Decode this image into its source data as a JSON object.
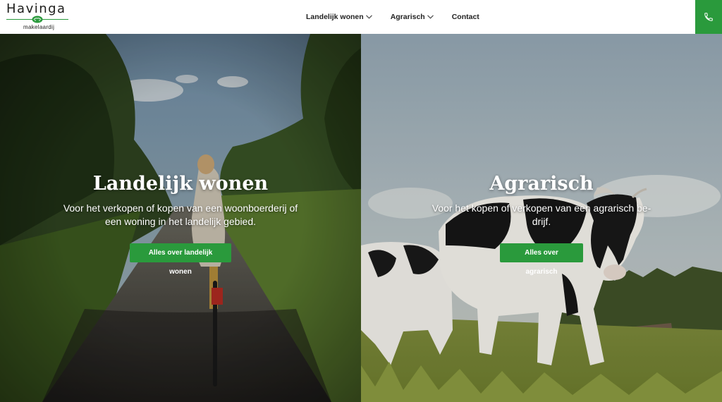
{
  "brand": {
    "name": "Havinga",
    "sub": "makelaardij",
    "green": "#2a9a3c"
  },
  "nav": {
    "items": [
      {
        "label": "Landelijk wonen",
        "has_dropdown": true
      },
      {
        "label": "Agrarisch",
        "has_dropdown": true
      },
      {
        "label": "Contact",
        "has_dropdown": false
      }
    ],
    "phone_icon": "phone-icon"
  },
  "hero": {
    "left": {
      "title": "Landelijk wonen",
      "description": "Voor het verkopen of kopen van een woonboerderij of een woning in het landelijk gebied.",
      "button": "Alles over landelijk wonen"
    },
    "right": {
      "title": "Agrarisch",
      "description": "Voor het kopen of verkopen van een agrarisch be-drijf.",
      "button": "Alles over agrarisch"
    }
  }
}
